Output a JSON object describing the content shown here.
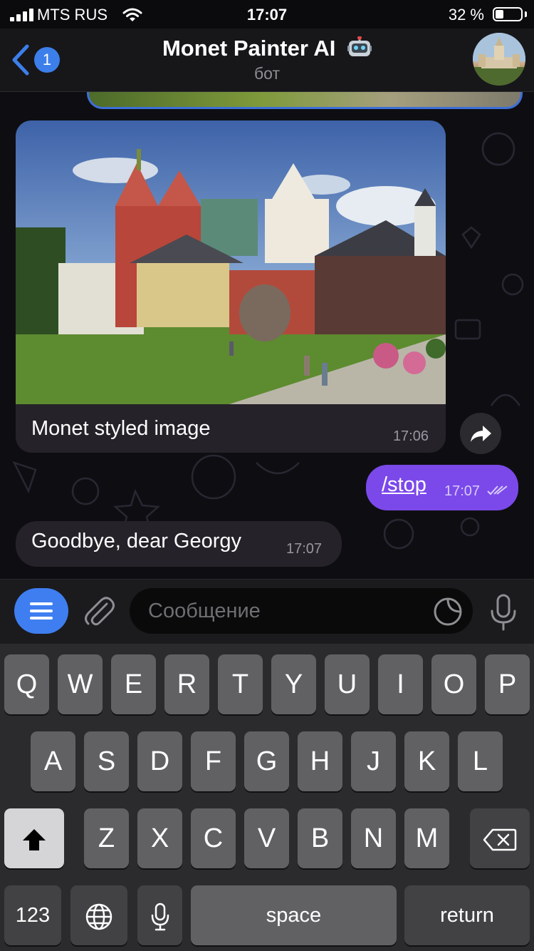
{
  "status_bar": {
    "carrier": "MTS RUS",
    "time": "17:07",
    "battery_percent": "32 %",
    "battery_level": 0.32
  },
  "header": {
    "back_badge": "1",
    "title": "Monet Painter AI",
    "subtitle": "бот",
    "title_icon": "robot-icon",
    "avatar_icon": "profile-photo"
  },
  "chat": {
    "photo_message": {
      "caption": "Monet styled image",
      "time": "17:06"
    },
    "outgoing_message": {
      "text": "/stop",
      "time": "17:07",
      "status_icon": "double-check-icon"
    },
    "incoming_message": {
      "text": "Goodbye, dear Georgy",
      "time": "17:07"
    }
  },
  "input_bar": {
    "placeholder": "Сообщение"
  },
  "keyboard": {
    "row1": [
      "Q",
      "W",
      "E",
      "R",
      "T",
      "Y",
      "U",
      "I",
      "O",
      "P"
    ],
    "row2": [
      "A",
      "S",
      "D",
      "F",
      "G",
      "H",
      "J",
      "K",
      "L"
    ],
    "row3": [
      "Z",
      "X",
      "C",
      "V",
      "B",
      "N",
      "M"
    ],
    "numbers_label": "123",
    "space_label": "space",
    "return_label": "return"
  },
  "colors": {
    "accent": "#3f7ef0",
    "outgoing_bubble": "#7b49ea",
    "incoming_bubble": "#262229"
  }
}
